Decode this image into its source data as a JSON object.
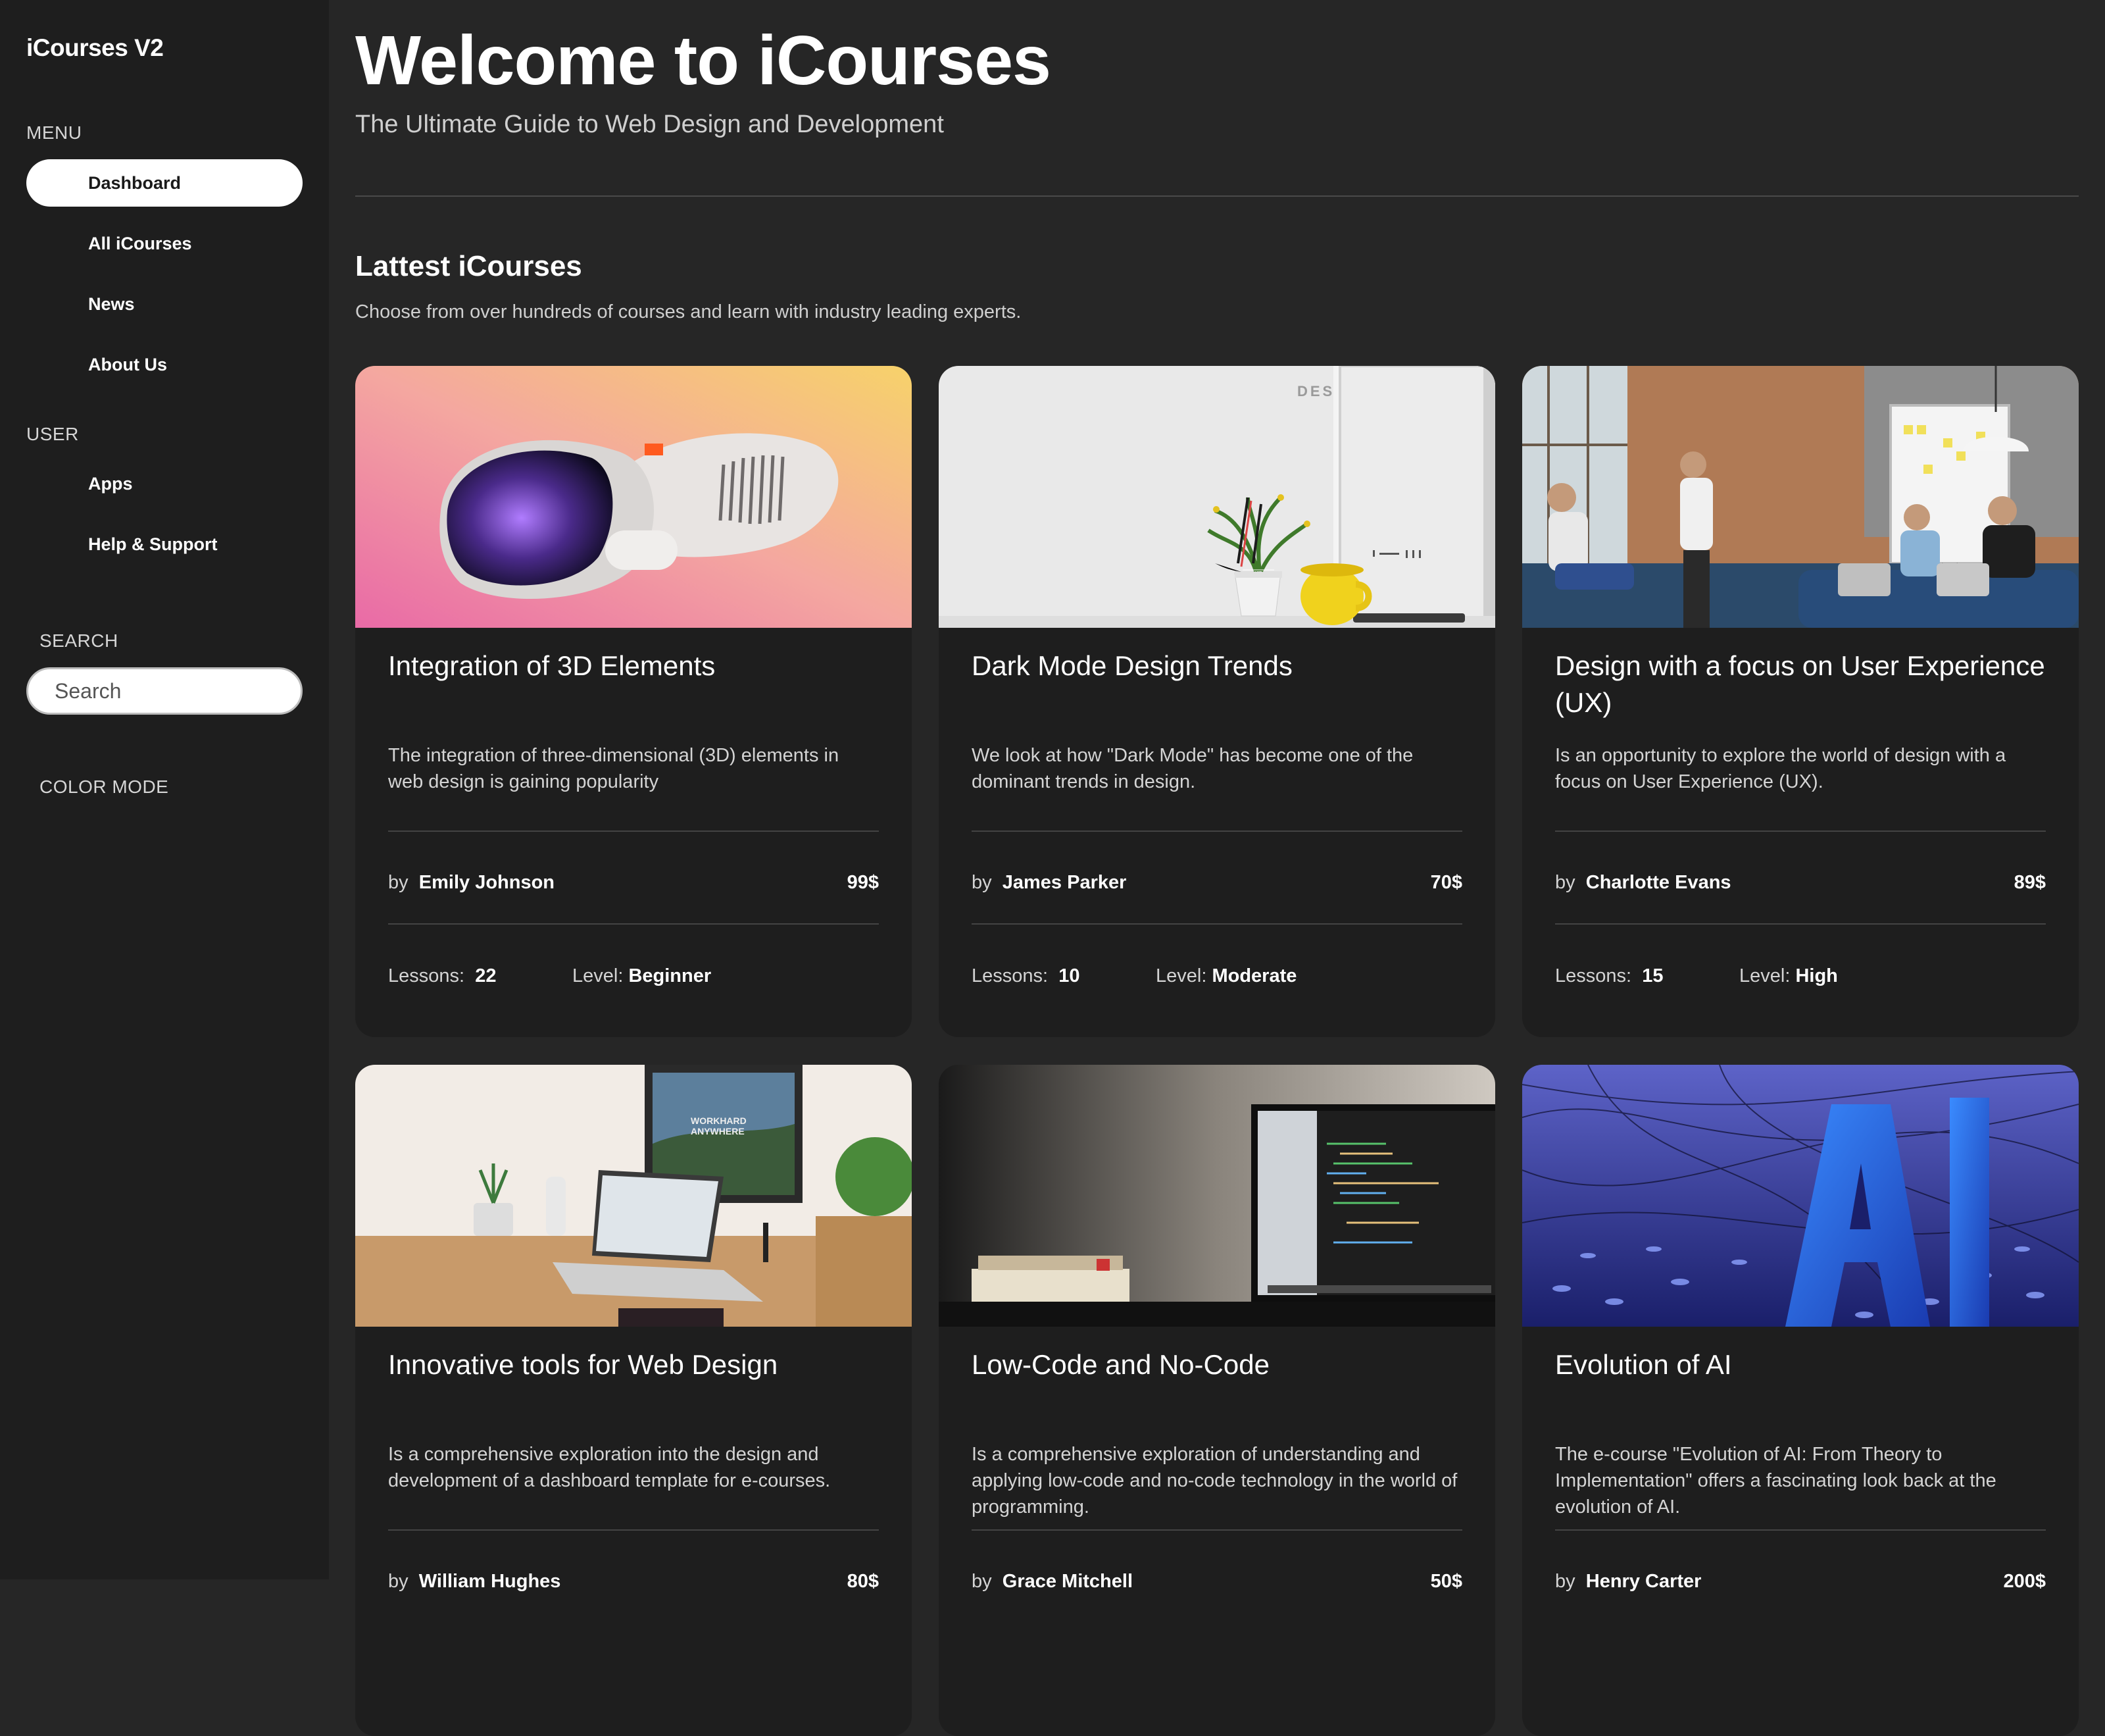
{
  "sidebar": {
    "brand": "iCourses V2",
    "menu_label": "MENU",
    "menu_items": [
      {
        "label": "Dashboard"
      },
      {
        "label": "All iCourses"
      },
      {
        "label": "News"
      },
      {
        "label": "About Us"
      }
    ],
    "user_label": "USER",
    "user_items": [
      {
        "label": "Apps"
      },
      {
        "label": "Help & Support"
      }
    ],
    "search_label": "SEARCH",
    "search_placeholder": "Search",
    "color_mode_label": "COLOR MODE"
  },
  "header": {
    "title": "Welcome to iCourses",
    "subtitle": "The Ultimate Guide to Web Design and Development"
  },
  "section": {
    "title": "Lattest iCourses",
    "description": "Choose from over hundreds of courses and learn with industry leading experts."
  },
  "labels": {
    "by": "by",
    "lessons": "Lessons:",
    "level": "Level:"
  },
  "courses": [
    {
      "title": "Integration of 3D Elements",
      "description": "The integration of three-dimensional (3D) elements in web design is gaining popularity",
      "author": "Emily Johnson",
      "price": "99$",
      "lessons": "22",
      "level": "Beginner"
    },
    {
      "title": "Dark Mode Design Trends",
      "description": "We look at how \"Dark Mode\" has become one of the dominant trends in design.",
      "author": "James Parker",
      "price": "70$",
      "lessons": "10",
      "level": "Moderate"
    },
    {
      "title": "Design with a focus on User Experience (UX)",
      "description": "Is an opportunity to explore the world of design with a focus on User Experience (UX).",
      "author": "Charlotte Evans",
      "price": "89$",
      "lessons": "15",
      "level": "High"
    },
    {
      "title": "Innovative tools for Web Design",
      "description": "Is a comprehensive exploration into the design and development of a dashboard template for e-courses.",
      "author": "William Hughes",
      "price": "80$",
      "lessons": "",
      "level": ""
    },
    {
      "title": "Low-Code and No-Code",
      "description": " Is a comprehensive exploration of understanding and applying low-code and no-code technology in the world of programming.",
      "author": "Grace Mitchell",
      "price": "50$",
      "lessons": "",
      "level": ""
    },
    {
      "title": "Evolution of AI",
      "description": "The e-course \"Evolution of AI: From Theory to Implementation\" offers a fascinating look back at the evolution of AI.",
      "author": "Henry Carter",
      "price": "200$",
      "lessons": "",
      "level": ""
    }
  ]
}
